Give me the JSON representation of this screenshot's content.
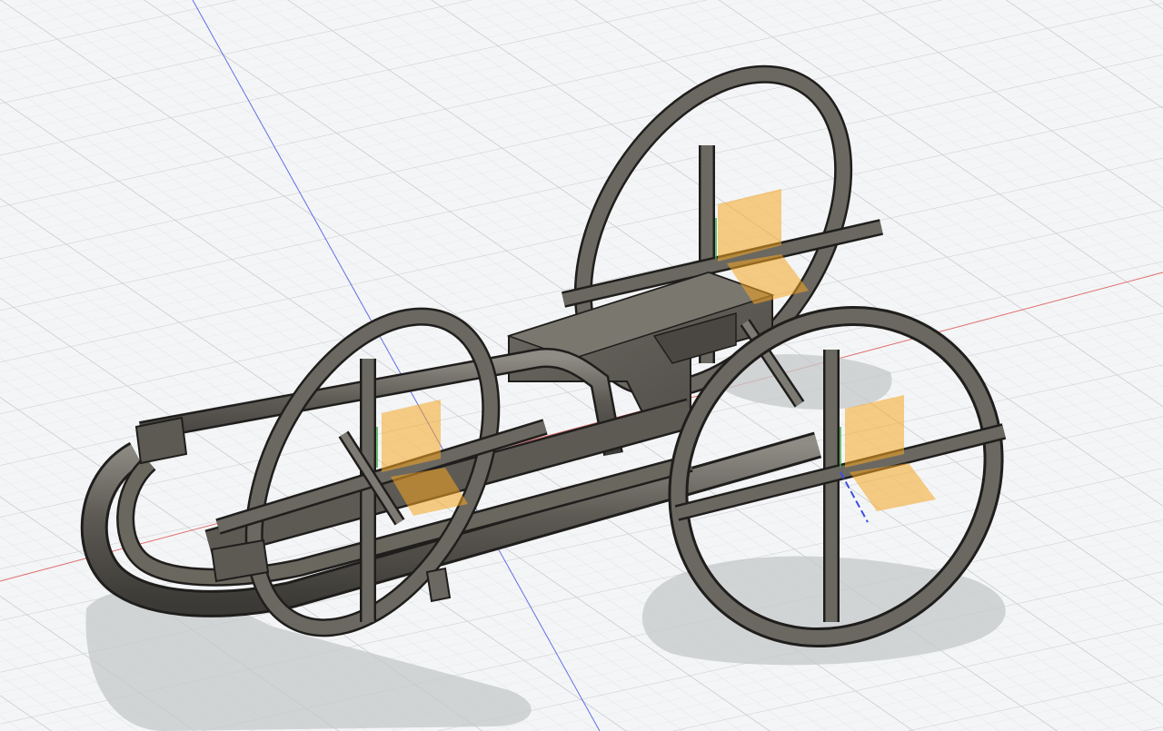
{
  "viewport": {
    "name": "3d-canvas",
    "background": "#f4f5f6",
    "grid_minor_color": "#dfe1e4",
    "grid_major_color": "#c8cbcf"
  },
  "axes": {
    "x_color": "#d94b4b",
    "y_color": "#3ea84a",
    "z_color": "#3b4fe0"
  },
  "model": {
    "name": "cart-chassis",
    "body_color": "#5d5a54",
    "edge_color": "#1f1e1c",
    "highlight_color": "#8f8c85",
    "shadow_color": "#c6c8ca",
    "joint_marker_color": "#f5a623"
  }
}
